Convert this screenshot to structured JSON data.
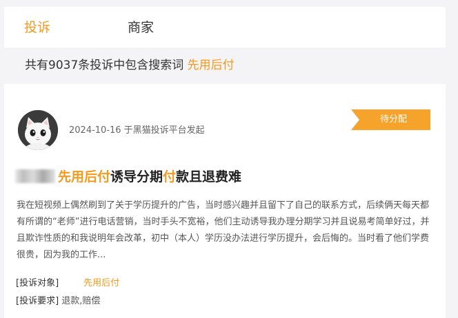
{
  "tabs": [
    {
      "label": "投诉",
      "active": true
    },
    {
      "label": "商家",
      "active": false
    }
  ],
  "summary": {
    "prefix": "共有9037条投诉中包含搜索词 ",
    "keyword": "先用后付"
  },
  "complaint": {
    "avatar_icon": "cat-avatar-icon",
    "meta": "2024-10-16 于黑猫投诉平台发起",
    "status_badge": "待分配",
    "title_hl1": "先用后付",
    "title_mid": "诱导分期",
    "title_hl2": "付",
    "title_end": "款且退费难",
    "body": "我在短视频上偶然刷到了关于学历提升的广告，当时感兴趣并且留下了自己的联系方式，后续俩天每天都有所谓的“老师”进行电话营销，当时手头不宽裕，他们主动诱导我办理分期学习并且说易考简单好过，并且欺诈性质的和我说明年会改革，初中（本人）学历没办法进行学历提升，会后悔的。当时看了他们学费很贵，因为我的工作...",
    "target_label": "[投诉对象]",
    "target_value": "先用后付",
    "request_label": "[投诉要求]",
    "request_value": "退款,赔偿"
  },
  "colors": {
    "accent": "#f39a1e",
    "badge": "#f5a32a",
    "background": "#f4f4f6"
  }
}
